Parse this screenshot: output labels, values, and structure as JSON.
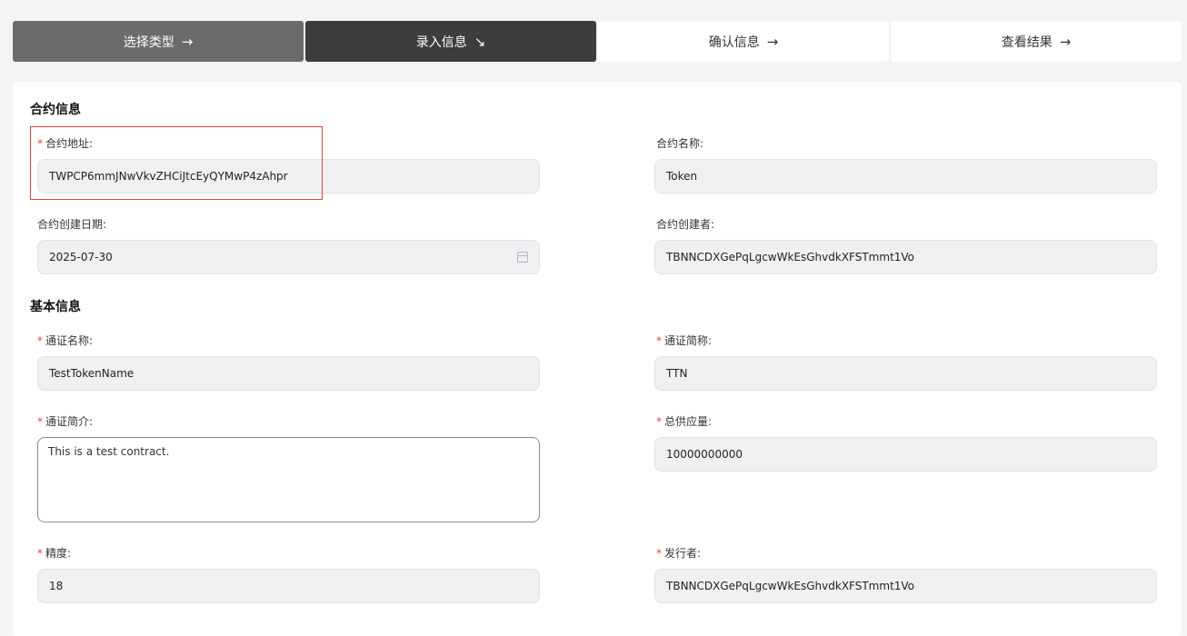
{
  "steps": [
    {
      "label": "选择类型",
      "arrow": "→",
      "state": "done"
    },
    {
      "label": "录入信息",
      "arrow": "↘",
      "state": "active"
    },
    {
      "label": "确认信息",
      "arrow": "→",
      "state": "todo"
    },
    {
      "label": "查看结果",
      "arrow": "→",
      "state": "todo"
    }
  ],
  "contract": {
    "section_title": "合约信息",
    "address_label": "合约地址:",
    "address_value": "TWPCP6mmJNwVkvZHCiJtcEyQYMwP4zAhpr",
    "name_label": "合约名称:",
    "name_value": "Token",
    "created_date_label": "合约创建日期:",
    "created_date_value": "2025-07-30",
    "creator_label": "合约创建者:",
    "creator_value": "TBNNCDXGePqLgcwWkEsGhvdkXFSTmmt1Vo"
  },
  "basic": {
    "section_title": "基本信息",
    "token_name_label": "通证名称:",
    "token_name_value": "TestTokenName",
    "token_symbol_label": "通证简称:",
    "token_symbol_value": "TTN",
    "intro_label": "通证简介:",
    "intro_value": "This is a test contract.",
    "supply_label": "总供应量:",
    "supply_value": "10000000000",
    "precision_label": "精度:",
    "precision_value": "18",
    "issuer_label": "发行者:",
    "issuer_value": "TBNNCDXGePqLgcwWkEsGhvdkXFSTmmt1Vo"
  },
  "required_mark": "*",
  "colors": {
    "required": "#e0453a",
    "step_done": "#6b6b6d",
    "step_active": "#3d3d40",
    "highlight": "#e0453a"
  }
}
